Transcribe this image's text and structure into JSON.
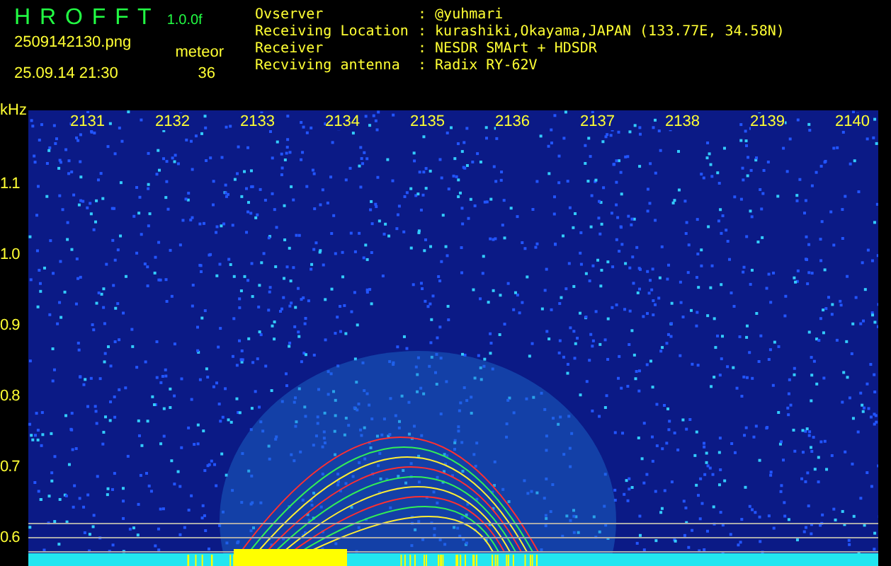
{
  "app": {
    "name": "H R O F F T",
    "version": "1.0.0f",
    "filename": "2509142130.png",
    "datetime": "25.09.14 21:30",
    "event_label": "meteor",
    "event_count": "36"
  },
  "info": [
    {
      "label": "Ovserver",
      "value": ": @yuhmari"
    },
    {
      "label": "Receiving Location",
      "value": ": kurashiki,Okayama,JAPAN (133.77E, 34.58N)"
    },
    {
      "label": "Receiver",
      "value": ": NESDR SMArt + HDSDR"
    },
    {
      "label": "Recviving antenna",
      "value": ": Radix RY-62V"
    }
  ],
  "plot": {
    "unit": "kHz",
    "time_labels": [
      "2131",
      "2132",
      "2133",
      "2134",
      "2135",
      "2136",
      "2137",
      "2138",
      "2139",
      "2140"
    ],
    "freq_labels": [
      "1.1",
      "1.0",
      "0.9",
      "0.8",
      "0.7",
      "0.6"
    ]
  }
}
